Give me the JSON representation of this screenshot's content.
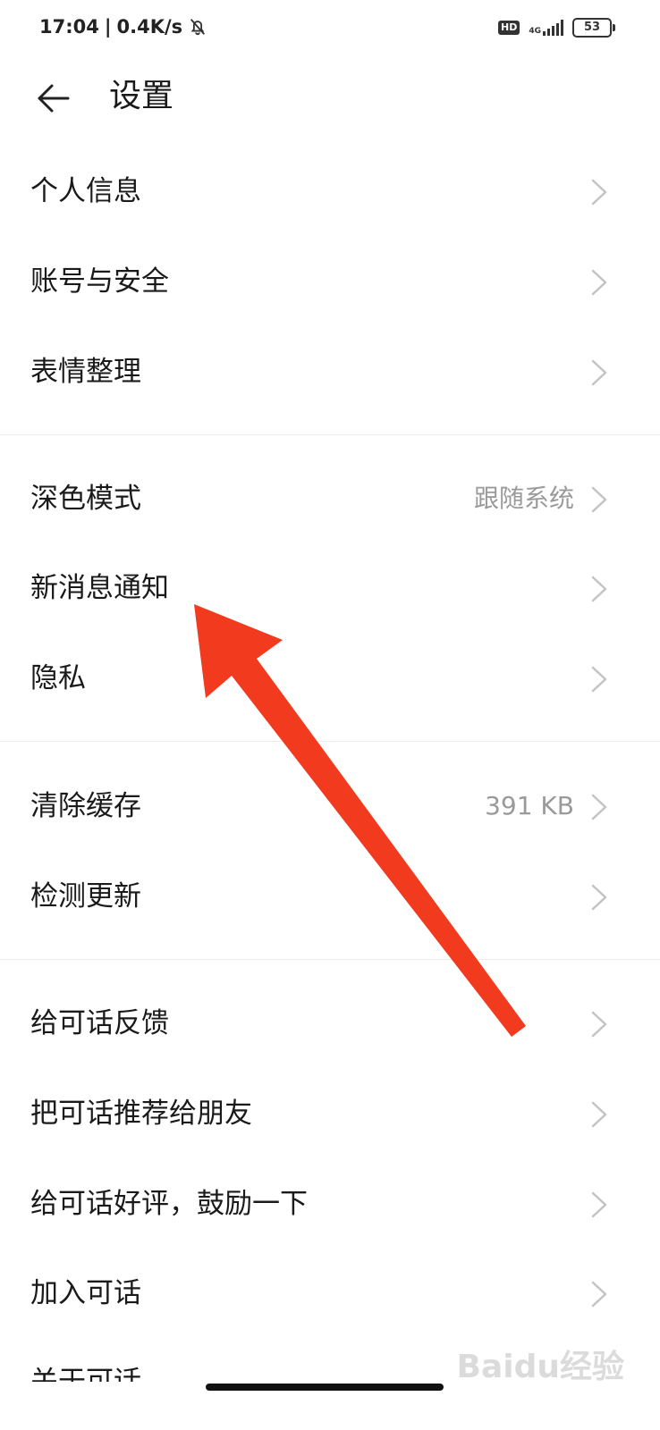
{
  "status_bar": {
    "time": "17:04",
    "network_speed": "0.4K/s",
    "hd_label": "HD",
    "network_type": "4G",
    "battery": "53"
  },
  "header": {
    "title": "设置"
  },
  "sections": [
    {
      "items": [
        {
          "label": "个人信息",
          "value": ""
        },
        {
          "label": "账号与安全",
          "value": ""
        },
        {
          "label": "表情整理",
          "value": ""
        }
      ]
    },
    {
      "items": [
        {
          "label": "深色模式",
          "value": "跟随系统"
        },
        {
          "label": "新消息通知",
          "value": ""
        },
        {
          "label": "隐私",
          "value": ""
        }
      ]
    },
    {
      "items": [
        {
          "label": "清除缓存",
          "value": "391 KB"
        },
        {
          "label": "检测更新",
          "value": ""
        }
      ]
    },
    {
      "items": [
        {
          "label": "给可话反馈",
          "value": ""
        },
        {
          "label": "把可话推荐给朋友",
          "value": ""
        },
        {
          "label": "给可话好评，鼓励一下",
          "value": ""
        },
        {
          "label": "加入可话",
          "value": ""
        },
        {
          "label": "关于可话",
          "value": ""
        }
      ]
    }
  ],
  "colors": {
    "annotation_arrow": "#f23a1e",
    "secondary_text": "#9a9a9a",
    "chevron": "#c4c4c4"
  },
  "watermark": "Baidu经验"
}
